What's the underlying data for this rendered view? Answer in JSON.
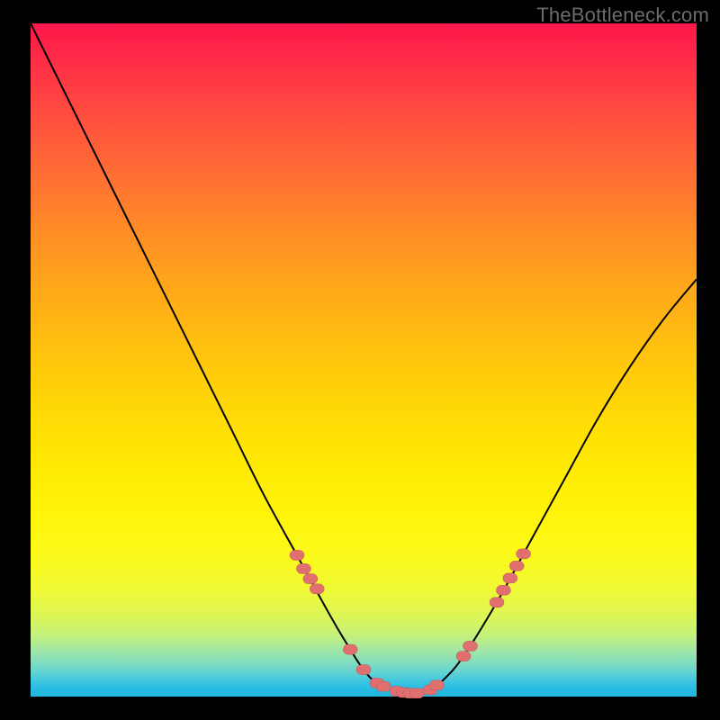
{
  "watermark": "TheBottleneck.com",
  "colors": {
    "background": "#000000",
    "curve_stroke": "#000000",
    "marker_fill": "#e07070",
    "marker_stroke": "#c05858"
  },
  "chart_data": {
    "type": "line",
    "title": "",
    "xlabel": "",
    "ylabel": "",
    "xlim": [
      0,
      100
    ],
    "ylim": [
      0,
      100
    ],
    "grid": false,
    "legend": false,
    "series": [
      {
        "name": "bottleneck-curve",
        "x": [
          0,
          5,
          10,
          15,
          20,
          25,
          30,
          35,
          40,
          45,
          48,
          50,
          52,
          55,
          58,
          60,
          62,
          65,
          70,
          75,
          80,
          85,
          90,
          95,
          100
        ],
        "y": [
          100,
          90,
          80,
          70,
          60,
          50,
          40,
          30,
          21,
          12,
          7,
          4,
          2,
          0.8,
          0.5,
          1,
          2.5,
          6,
          14,
          23,
          32,
          41,
          49,
          56,
          62
        ]
      }
    ],
    "markers": {
      "name": "highlighted-points",
      "x": [
        40,
        41,
        42,
        43,
        48,
        50,
        52,
        53,
        55,
        56,
        57,
        58,
        60,
        61,
        65,
        66,
        70,
        71,
        72,
        73,
        74
      ],
      "y": [
        21,
        19,
        17.5,
        16,
        7,
        4,
        2,
        1.5,
        0.8,
        0.6,
        0.5,
        0.5,
        1,
        1.7,
        6,
        7.5,
        14,
        15.8,
        17.6,
        19.4,
        21.2
      ]
    }
  }
}
